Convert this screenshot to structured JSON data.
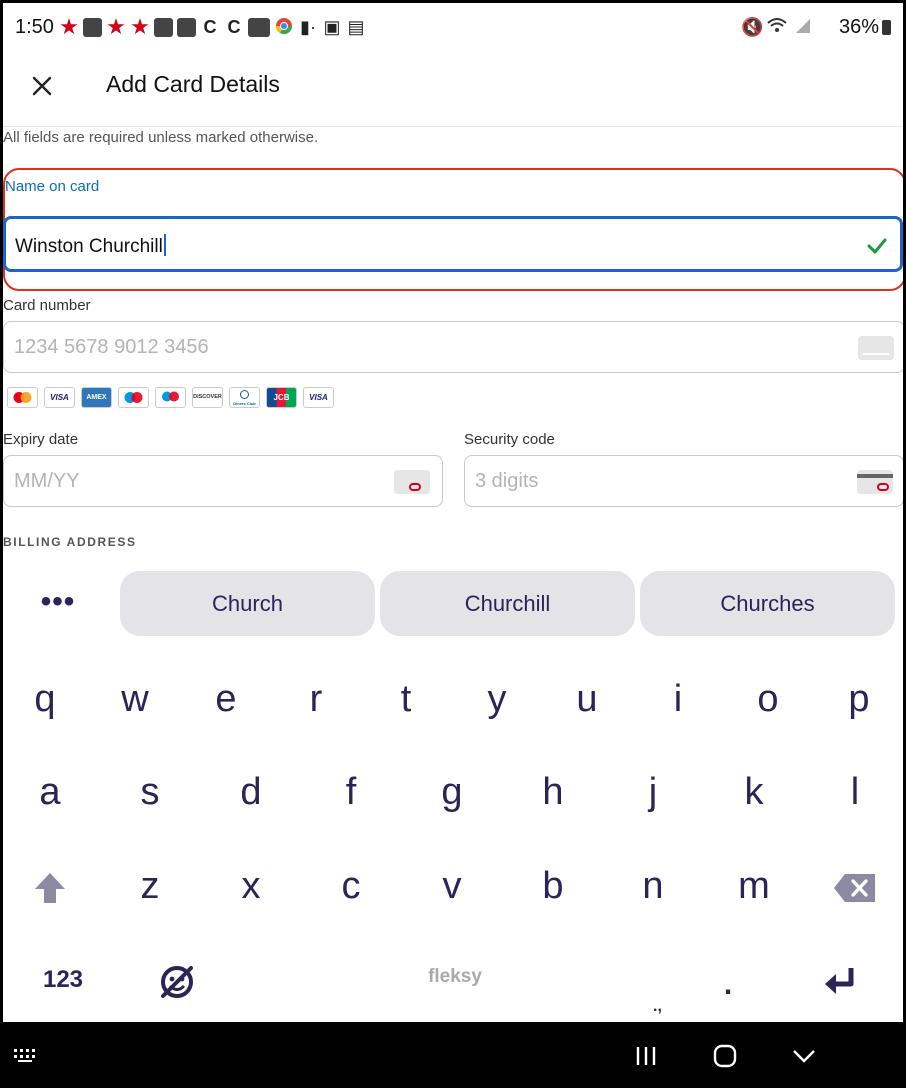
{
  "status_bar": {
    "time": "1:50",
    "battery": "36%",
    "app_icons": [
      "star-icon",
      "shopping-bag-icon",
      "star-icon",
      "star-icon",
      "shopping-bag-icon",
      "shopping-bag-icon",
      "c-app-icon",
      "c-app-icon",
      "ebay-icon",
      "chrome-icon",
      "dot-icon",
      "image-icon",
      "calendar-icon"
    ]
  },
  "header": {
    "title": "Add Card Details"
  },
  "form": {
    "helper_text": "All fields are required unless marked otherwise.",
    "name_label": "Name on card",
    "name_value": "Winston Churchill",
    "card_number_label": "Card number",
    "card_number_placeholder": "1234 5678 9012 3456",
    "expiry_label": "Expiry date",
    "expiry_placeholder": "MM/YY",
    "security_label": "Security code",
    "security_placeholder": "3 digits",
    "billing_heading": "BILLING ADDRESS",
    "brands": [
      "Mastercard",
      "VISA",
      "AMEX",
      "Maestro",
      "Maestro",
      "DISCOVER",
      "Diners Club",
      "JCB",
      "VISA"
    ]
  },
  "keyboard": {
    "more": "•••",
    "suggestions": [
      "Church",
      "Churchill",
      "Churches"
    ],
    "row1": [
      "q",
      "w",
      "e",
      "r",
      "t",
      "y",
      "u",
      "i",
      "o",
      "p"
    ],
    "row2": [
      "a",
      "s",
      "d",
      "f",
      "g",
      "h",
      "j",
      "k",
      "l"
    ],
    "row3": [
      "z",
      "x",
      "c",
      "v",
      "b",
      "n",
      "m"
    ],
    "numbers_key": "123",
    "brand": "fleksy",
    "period_key": ".",
    "punct_hint": ".,"
  },
  "colors": {
    "highlight_red": "#e0301e",
    "focus_blue": "#1d63c8",
    "label_blue": "#0b6db3",
    "check_green": "#1e9a3a",
    "keyboard_text": "#2a2457",
    "suggestion_bg": "#e3e3e8"
  }
}
